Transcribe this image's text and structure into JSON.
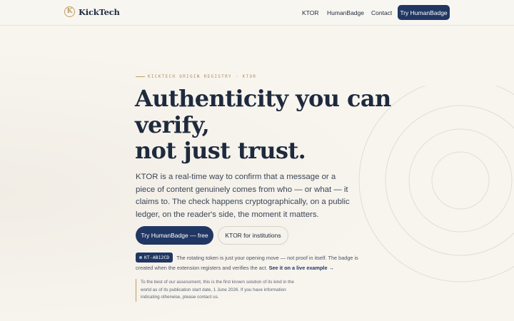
{
  "header": {
    "brand": "KickTech",
    "logo_letter": "K",
    "nav": [
      "KTOR",
      "HumanBadge",
      "Contact"
    ],
    "cta": "Try HumanBadge"
  },
  "hero": {
    "eyebrow": "KICKTECH ORIGIN REGISTRY · KTOR",
    "headline_lines": [
      "Authenticity you can",
      "verify,",
      "not just trust."
    ],
    "lead": "KTOR is a real-time way to confirm that a message or a piece of content genuinely comes from who — or what — it claims to. The check happens cryptographically, on a public ledger, on the reader's side, the moment it matters.",
    "primary_button": "Try HumanBadge — free",
    "secondary_button": "KTOR for institutions",
    "token": "KT-AB12CD",
    "token_note": "The rotating token is just your opening move — not proof in itself. The badge is created when the extension registers and verifies the act.",
    "live_link": "See it on a live example →",
    "disclaimer": "To the best of our assessment, this is the first known solution of its kind in the world as of its publication start date, 1 June 2026. If you have information indicating otherwise, please contact us."
  },
  "colors": {
    "accent": "#213763",
    "gold": "#c39a62",
    "background": "#f8f5ef"
  }
}
